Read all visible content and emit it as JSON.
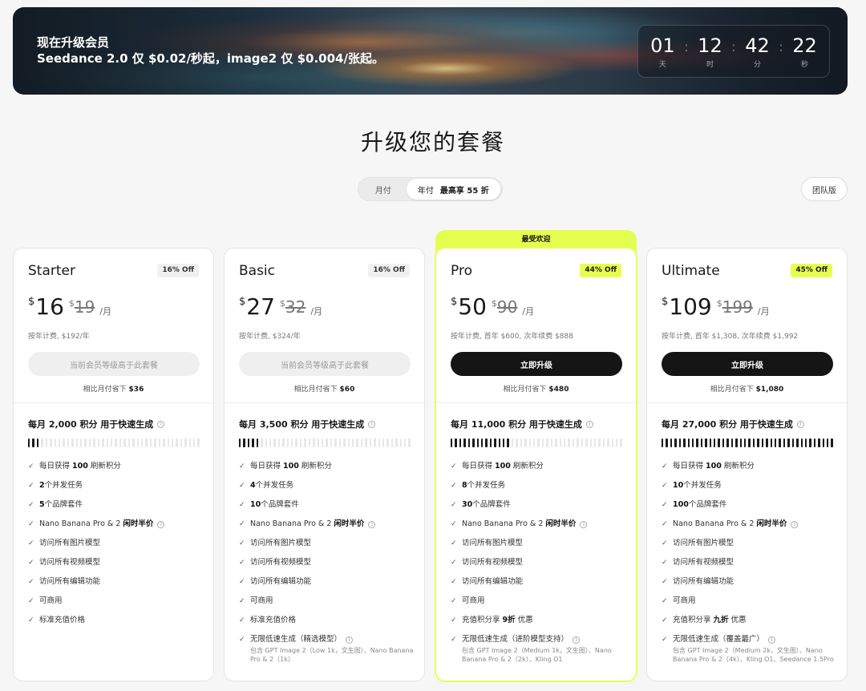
{
  "banner": {
    "title": "现在升级会员",
    "subtitle": "Seedance 2.0 仅 $0.02/秒起，image2 仅 $0.004/张起。",
    "countdown": [
      {
        "value": "01",
        "label": "天"
      },
      {
        "value": "12",
        "label": "时"
      },
      {
        "value": "42",
        "label": "分"
      },
      {
        "value": "22",
        "label": "秒"
      }
    ]
  },
  "heading": "升级您的套餐",
  "toggle": {
    "monthly": "月付",
    "yearly": "年付",
    "promo": "最高享 55 折"
  },
  "team_button": "团队版",
  "popular_label": "最受欢迎",
  "colors": {
    "accent": "#e4ff4f",
    "dark": "#151515"
  },
  "plans": [
    {
      "name": "Starter",
      "off": "16% Off",
      "currency": "$",
      "price": "16",
      "old_price": "19",
      "per": "/月",
      "billing": "按年计费, $192/年",
      "cta": "当前会员等级高于此套餐",
      "save_prefix": "相比月付省下",
      "save_amount": "$36",
      "credits": "每月 2,000 积分 用于快速生成",
      "meter_filled": 3,
      "features": [
        {
          "strong": "",
          "text": "每日获得",
          "strong2": "100",
          "text2": "刷新积分"
        },
        {
          "strong": "2",
          "text": "个并发任务"
        },
        {
          "strong": "5",
          "text": "个品牌套件"
        },
        {
          "text": "Nano Banana Pro & 2",
          "strong2": "闲时半价",
          "info": true
        },
        {
          "text": "访问所有图片模型"
        },
        {
          "text": "访问所有视频模型"
        },
        {
          "text": "访问所有编辑功能"
        },
        {
          "text": "可商用"
        },
        {
          "text": "标准充值价格"
        }
      ]
    },
    {
      "name": "Basic",
      "off": "16% Off",
      "currency": "$",
      "price": "27",
      "old_price": "32",
      "per": "/月",
      "billing": "按年计费, $324/年",
      "cta": "当前会员等级高于此套餐",
      "save_prefix": "相比月付省下",
      "save_amount": "$60",
      "credits": "每月 3,500 积分 用于快速生成",
      "meter_filled": 5,
      "features": [
        {
          "text": "每日获得",
          "strong2": "100",
          "text2": "刷新积分"
        },
        {
          "strong": "4",
          "text": "个并发任务"
        },
        {
          "strong": "10",
          "text": "个品牌套件"
        },
        {
          "text": "Nano Banana Pro & 2",
          "strong2": "闲时半价",
          "info": true
        },
        {
          "text": "访问所有图片模型"
        },
        {
          "text": "访问所有视频模型"
        },
        {
          "text": "访问所有编辑功能"
        },
        {
          "text": "可商用"
        },
        {
          "text": "标准充值价格"
        },
        {
          "text": "无限低速生成（精选模型）",
          "info": true,
          "note": "包含 GPT Image 2（Low 1k，文生图）、Nano Banana Pro & 2（1k）"
        }
      ]
    },
    {
      "name": "Pro",
      "off": "44% Off",
      "currency": "$",
      "price": "50",
      "old_price": "90",
      "per": "/月",
      "billing": "按年计费, 首年 $600, 次年续费 $888",
      "cta": "立即升级",
      "save_prefix": "相比月付省下",
      "save_amount": "$480",
      "credits": "每月 11,000 积分 用于快速生成",
      "meter_filled": 14,
      "features": [
        {
          "text": "每日获得",
          "strong2": "100",
          "text2": "刷新积分"
        },
        {
          "strong": "8",
          "text": "个并发任务"
        },
        {
          "strong": "30",
          "text": "个品牌套件"
        },
        {
          "text": "Nano Banana Pro & 2",
          "strong2": "闲时半价",
          "info": true
        },
        {
          "text": "访问所有图片模型"
        },
        {
          "text": "访问所有视频模型"
        },
        {
          "text": "访问所有编辑功能"
        },
        {
          "text": "可商用"
        },
        {
          "text": "充值积分享",
          "strong2": "9折",
          "text2": "优惠"
        },
        {
          "text": "无限低速生成（进阶模型支持）",
          "info": true,
          "note": "包含 GPT Image 2（Medium 1k，文生图）、Nano Banana Pro & 2（2k）、Kling O1"
        }
      ]
    },
    {
      "name": "Ultimate",
      "off": "45% Off",
      "currency": "$",
      "price": "109",
      "old_price": "199",
      "per": "/月",
      "billing": "按年计费, 首年 $1,308, 次年续费 $1,992",
      "cta": "立即升级",
      "save_prefix": "相比月付省下",
      "save_amount": "$1,080",
      "credits": "每月 27,000 积分 用于快速生成",
      "meter_filled": 40,
      "features": [
        {
          "text": "每日获得",
          "strong2": "100",
          "text2": "刷新积分"
        },
        {
          "strong": "10",
          "text": "个并发任务"
        },
        {
          "strong": "100",
          "text": "个品牌套件"
        },
        {
          "text": "Nano Banana Pro & 2",
          "strong2": "闲时半价",
          "info": true
        },
        {
          "text": "访问所有图片模型"
        },
        {
          "text": "访问所有视频模型"
        },
        {
          "text": "访问所有编辑功能"
        },
        {
          "text": "可商用"
        },
        {
          "text": "充值积分享",
          "strong2": "九折",
          "text2": "优惠"
        },
        {
          "text": "无限低速生成（覆盖最广）",
          "info": true,
          "note": "包含 GPT Image 2（Medium 2k，文生图）、Nano Banana Pro & 2（4k）、Kling O1、Seedance 1.5Pro"
        }
      ]
    }
  ]
}
